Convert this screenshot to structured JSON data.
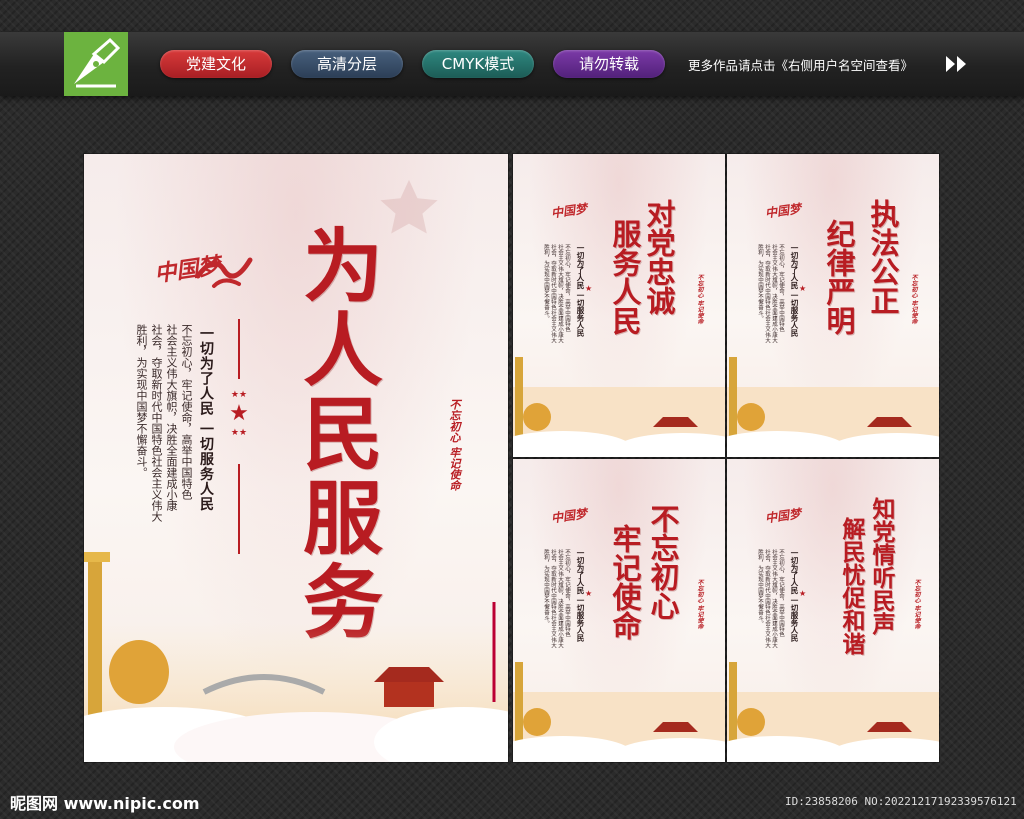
{
  "topbar": {
    "tags": [
      {
        "label": "党建文化",
        "color": "#c0292d"
      },
      {
        "label": "高清分层",
        "color": "#3a506b"
      },
      {
        "label": "CMYK模式",
        "color": "#26746d"
      },
      {
        "label": "请勿转载",
        "color": "#6a2d93"
      }
    ],
    "hint": "更多作品请点击《右侧用户名空间查看》"
  },
  "main_poster": {
    "brand": "中国梦",
    "title": "为人民服务",
    "slogan": "一切为了人民 一切服务人民",
    "body": [
      "不忘初心，牢记使命，高举中国特色",
      "社会主义伟大旗帜，决胜全面建成小康",
      "社会，夺取新时代中国特色社会主义伟大",
      "胜利，为实现中国梦不懈奋斗。"
    ],
    "stamp": "不忘初心 牢记使命"
  },
  "small_posters": [
    {
      "title_a": "对党忠诚",
      "title_b": "服务人民"
    },
    {
      "title_a": "执法公正",
      "title_b": "纪律严明"
    },
    {
      "title_a": "不忘初心",
      "title_b": "牢记使命"
    },
    {
      "title_a": "知党情听民声",
      "title_b": "解民忧促和谐"
    }
  ],
  "small_common": {
    "brand": "中国梦",
    "slogan": "一切为了人民 一切服务人民",
    "stamp": "不忘初心 牢记使命",
    "body": [
      "不忘初心，牢记使命，高举中国特色",
      "社会主义伟大旗帜，决胜全面建成小康大",
      "社会，夺取新时代中国特色社会主义伟大",
      "胜利，为实现中国梦不懈奋斗。"
    ]
  },
  "footer": {
    "site": "昵图网 www.nipic.com",
    "id": "ID:23858206 NO:20221217192339576121"
  },
  "colors": {
    "accent_red": "#b81c22",
    "logo_green": "#6cb33f"
  }
}
